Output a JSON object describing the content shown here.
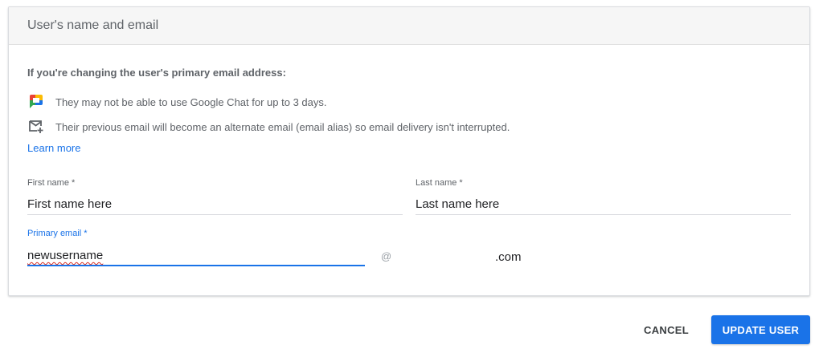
{
  "card": {
    "title": "User's name and email"
  },
  "notice": {
    "title": "If you're changing the user's primary email address:",
    "items": [
      {
        "icon": "google-chat-icon",
        "text": "They may not be able to use Google Chat for up to 3 days."
      },
      {
        "icon": "mail-alias-icon",
        "text": "Their previous email will become an alternate email (email alias) so email delivery isn't interrupted."
      }
    ],
    "learn_more": "Learn more"
  },
  "form": {
    "first_name": {
      "label": "First name *",
      "value": "First name here"
    },
    "last_name": {
      "label": "Last name *",
      "value": "Last name here"
    },
    "primary_email": {
      "label": "Primary email *",
      "value": "newusername",
      "at": "@",
      "domain": ".com"
    }
  },
  "actions": {
    "cancel": "CANCEL",
    "update": "UPDATE USER"
  },
  "colors": {
    "accent": "#1a73e8",
    "header_bg": "#f6f6f6",
    "muted_text": "#5f6368"
  }
}
